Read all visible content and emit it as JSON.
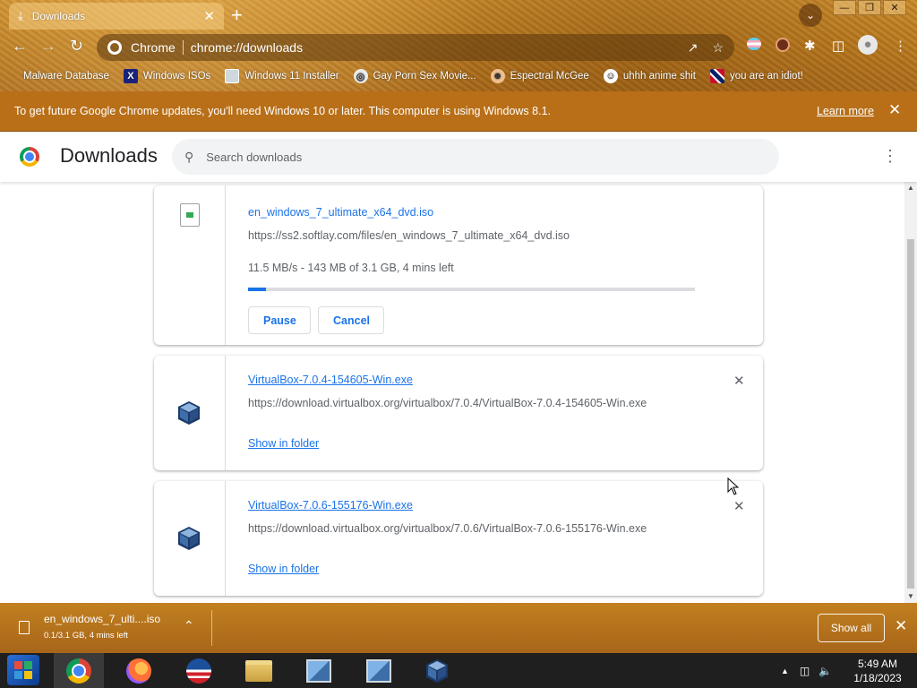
{
  "tab": {
    "label": "Downloads"
  },
  "omnibox": {
    "site": "Chrome",
    "url": "chrome://downloads"
  },
  "bookmarks": [
    {
      "label": "Malware Database",
      "icon": "blank-bookmark-icon"
    },
    {
      "label": "Windows ISOs",
      "icon": "x-logo-icon"
    },
    {
      "label": "Windows 11 Installer",
      "icon": "image-icon"
    },
    {
      "label": "Gay Porn Sex Movie...",
      "icon": "globe-icon"
    },
    {
      "label": "Espectral McGee",
      "icon": "avatar-icon"
    },
    {
      "label": "uhhh anime shit",
      "icon": "anime-icon"
    },
    {
      "label": "you are an idiot!",
      "icon": "flag-icon"
    }
  ],
  "infobar": {
    "message": "To get future Google Chrome updates, you'll need Windows 10 or later. This computer is using Windows 8.1.",
    "link": "Learn more"
  },
  "header": {
    "title": "Downloads",
    "search_placeholder": "Search downloads"
  },
  "downloads": [
    {
      "filename": "en_windows_7_ultimate_x64_dvd.iso",
      "url": "https://ss2.softlay.com/files/en_windows_7_ultimate_x64_dvd.iso",
      "status": "11.5 MB/s - 143 MB of 3.1 GB, 4 mins left",
      "progress": 0.04,
      "pause_label": "Pause",
      "cancel_label": "Cancel"
    },
    {
      "filename": "VirtualBox-7.0.4-154605-Win.exe",
      "url": "https://download.virtualbox.org/virtualbox/7.0.4/VirtualBox-7.0.4-154605-Win.exe",
      "action_label": "Show in folder"
    },
    {
      "filename": "VirtualBox-7.0.6-155176-Win.exe",
      "url": "https://download.virtualbox.org/virtualbox/7.0.6/VirtualBox-7.0.6-155176-Win.exe",
      "action_label": "Show in folder"
    }
  ],
  "shelf": {
    "name": "en_windows_7_ulti....iso",
    "sub": "0.1/3.1 GB, 4 mins left",
    "show_all": "Show all"
  },
  "taskbar": {
    "apps": [
      "chrome-icon",
      "firefox-icon",
      "obama-logo-icon",
      "file-explorer-icon",
      "network-setup-icon",
      "network-setup-icon",
      "virtualbox-icon"
    ],
    "time": "5:49 AM",
    "date": "1/18/2023"
  },
  "colors": {
    "accent": "#1a73e8",
    "infobar": "#b86f18"
  }
}
